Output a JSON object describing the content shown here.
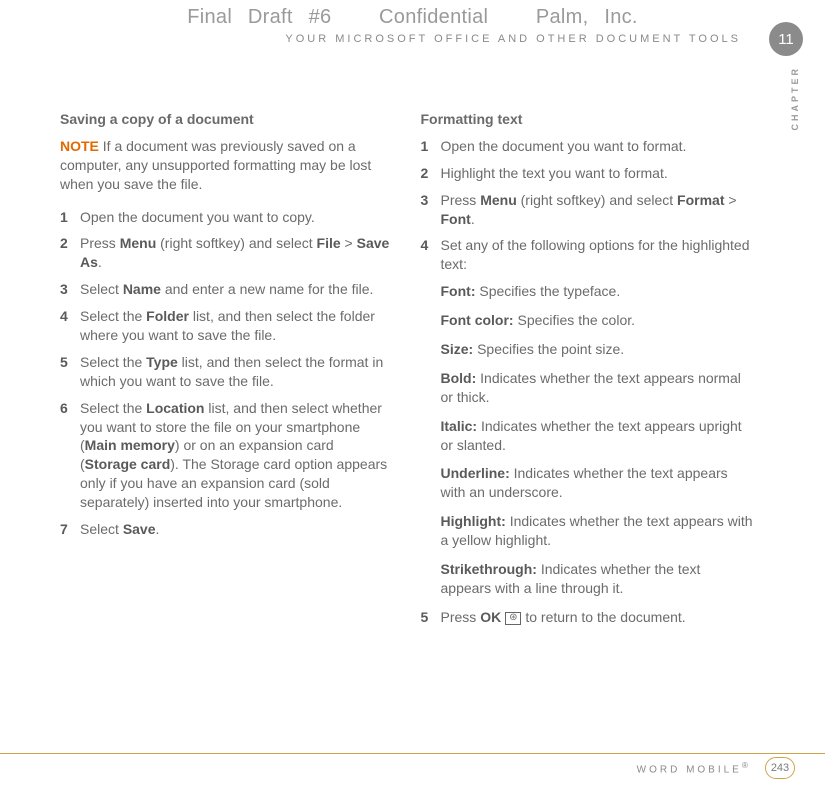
{
  "header": {
    "draft": "Final Draft #6",
    "confidential": "Confidential",
    "company": "Palm, Inc.",
    "running_head": "YOUR MICROSOFT OFFICE AND OTHER DOCUMENT TOOLS",
    "chapter_number": "11",
    "side_label": "CHAPTER"
  },
  "left": {
    "title": "Saving a copy of a document",
    "note_label": "NOTE",
    "note_text": "  If a document was previously saved on a computer, any unsupported formatting may be lost when you save the file.",
    "steps": [
      {
        "n": "1",
        "pre": "Open the document you want to copy."
      },
      {
        "n": "2",
        "pre": "Press ",
        "b1": "Menu",
        "mid": " (right softkey) and select ",
        "b2": "File",
        "post": " > ",
        "b3": "Save As",
        "tail": "."
      },
      {
        "n": "3",
        "pre": "Select ",
        "b1": "Name",
        "post": " and enter a new name for the file."
      },
      {
        "n": "4",
        "pre": "Select the ",
        "b1": "Folder",
        "post": " list, and then select the folder where you want to save the file."
      },
      {
        "n": "5",
        "pre": "Select the ",
        "b1": "Type",
        "post": " list, and then select the format in which you want to save the file."
      },
      {
        "n": "6",
        "pre": "Select the ",
        "b1": "Location",
        "mid": " list, and then select whether you want to store the file on your smartphone (",
        "b2": "Main memory",
        "post": ") or on an expansion card (",
        "b3": "Storage card",
        "tail": "). The Storage card option appears only if you have an expansion card (sold separately) inserted into your smartphone."
      },
      {
        "n": "7",
        "pre": "Select ",
        "b1": "Save",
        "post": "."
      }
    ]
  },
  "right": {
    "title": "Formatting text",
    "steps_top": [
      {
        "n": "1",
        "text": "Open the document you want to format."
      },
      {
        "n": "2",
        "text": "Highlight the text you want to format."
      },
      {
        "n": "3",
        "pre": "Press ",
        "b1": "Menu",
        "mid": " (right softkey) and select ",
        "b2": "Format",
        "post": " > ",
        "b3": "Font",
        "tail": "."
      },
      {
        "n": "4",
        "text": "Set any of the following options for the highlighted text:"
      }
    ],
    "options": [
      {
        "label": "Font:",
        "desc": " Specifies the typeface."
      },
      {
        "label": "Font color:",
        "desc": " Specifies the color."
      },
      {
        "label": "Size:",
        "desc": " Specifies the point size."
      },
      {
        "label": "Bold:",
        "desc": " Indicates whether the text appears normal or thick."
      },
      {
        "label": "Italic:",
        "desc": " Indicates whether the text appears upright or slanted."
      },
      {
        "label": "Underline:",
        "desc": " Indicates whether the text appears with an underscore."
      },
      {
        "label": "Highlight:",
        "desc": " Indicates whether the text appears with a yellow highlight."
      },
      {
        "label": "Strikethrough:",
        "desc": " Indicates whether the text appears with a line through it."
      }
    ],
    "step5": {
      "n": "5",
      "pre": "Press ",
      "b1": "OK",
      "icon": "⊛",
      "post": " to return to the document."
    }
  },
  "footer": {
    "section": "WORD MOBILE",
    "reg": "®",
    "page": "243"
  }
}
